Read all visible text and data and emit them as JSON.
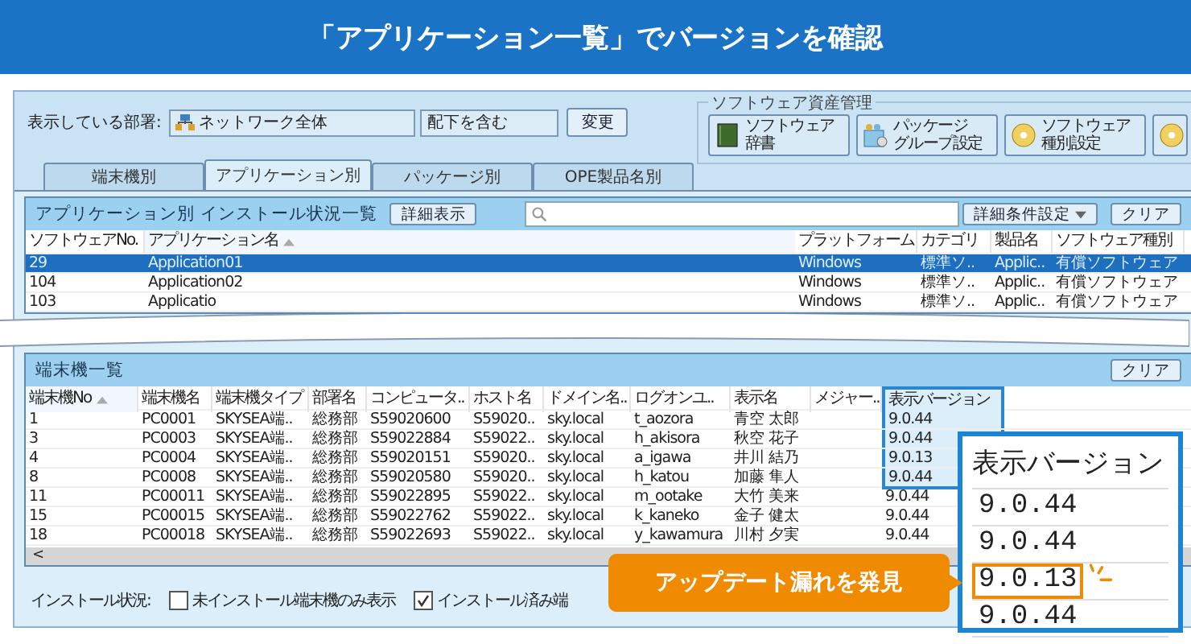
{
  "header": {
    "title": "「アプリケーション一覧」でバージョンを確認"
  },
  "toolbar": {
    "label": "表示している部署:",
    "department": "ネットワーク全体",
    "scope": "配下を含む",
    "change_button": "変更"
  },
  "asset_group": {
    "title": "ソフトウェア資産管理",
    "buttons": [
      {
        "kind": "book",
        "lines": [
          "ソフトウェア",
          "辞書"
        ]
      },
      {
        "kind": "package",
        "lines": [
          "パッケージ",
          "グループ設定"
        ]
      },
      {
        "kind": "disc",
        "lines": [
          "ソフトウェア",
          "種別設定"
        ]
      },
      {
        "kind": "disc"
      }
    ]
  },
  "tabs": [
    {
      "label": "端末機別",
      "selected": false
    },
    {
      "label": "アプリケーション別",
      "selected": true
    },
    {
      "label": "パッケージ別",
      "selected": false
    },
    {
      "label": "OPE製品名別",
      "selected": false
    }
  ],
  "app_panel": {
    "title": "アプリケーション別 インストール状況一覧",
    "detail_button": "詳細表示",
    "filter_button": "詳細条件設定",
    "clear_button": "クリア",
    "columns": [
      {
        "label": "ソフトウェアNo.",
        "sorted": false
      },
      {
        "label": "アプリケーション名",
        "sorted": true
      },
      {
        "label": "プラットフォーム",
        "sorted": false
      },
      {
        "label": "カテゴリ",
        "sorted": false
      },
      {
        "label": "製品名",
        "sorted": false
      },
      {
        "label": "ソフトウェア種別",
        "sorted": false
      }
    ],
    "rows": [
      {
        "selected": true,
        "cells": [
          "29",
          "Application01",
          "Windows",
          "標準ソ..",
          "Applic..",
          "有償ソフトウェア"
        ]
      },
      {
        "selected": false,
        "cells": [
          "104",
          "Application02",
          "Windows",
          "標準ソ..",
          "Applic..",
          "有償ソフトウェア"
        ]
      },
      {
        "selected": false,
        "cells": [
          "103",
          "Applicatio",
          "Windows",
          "標準ソ..",
          "Applic..",
          "有償ソフトウェア"
        ]
      }
    ]
  },
  "device_panel": {
    "title": "端末機一覧",
    "clear_button": "クリア",
    "columns": [
      {
        "label": "端末機No",
        "sorted": true,
        "highlighted": false
      },
      {
        "label": "端末機名",
        "sorted": false,
        "highlighted": false
      },
      {
        "label": "端末機タイプ",
        "sorted": false,
        "highlighted": false
      },
      {
        "label": "部署名",
        "sorted": false,
        "highlighted": false
      },
      {
        "label": "コンピュータ..",
        "sorted": false,
        "highlighted": false
      },
      {
        "label": "ホスト名",
        "sorted": false,
        "highlighted": false
      },
      {
        "label": "ドメイン名..",
        "sorted": false,
        "highlighted": false
      },
      {
        "label": "ログオンユ..",
        "sorted": false,
        "highlighted": false
      },
      {
        "label": "表示名",
        "sorted": false,
        "highlighted": false
      },
      {
        "label": "メジャー..",
        "sorted": false,
        "highlighted": false
      },
      {
        "label": "表示バージョン",
        "sorted": false,
        "highlighted": true
      }
    ],
    "rows": [
      {
        "highlighted": true,
        "cells": [
          "1",
          "PC0001",
          "SKYSEA端..",
          "総務部",
          "S59020600",
          "S59020..",
          "sky.local",
          "t_aozora",
          "青空 太郎",
          null,
          "9.0.44"
        ]
      },
      {
        "highlighted": true,
        "cells": [
          "3",
          "PC0003",
          "SKYSEA端..",
          "総務部",
          "S59022884",
          "S59022..",
          "sky.local",
          "h_akisora",
          "秋空 花子",
          null,
          "9.0.44"
        ]
      },
      {
        "highlighted": true,
        "cells": [
          "4",
          "PC0004",
          "SKYSEA端..",
          "総務部",
          "S59020151",
          "S59020..",
          "sky.local",
          "a_igawa",
          "井川 結乃",
          null,
          "9.0.13"
        ]
      },
      {
        "highlighted": true,
        "cells": [
          "8",
          "PC0008",
          "SKYSEA端..",
          "総務部",
          "S59020580",
          "S59020..",
          "sky.local",
          "h_katou",
          "加藤 隼人",
          null,
          "9.0.44"
        ]
      },
      {
        "highlighted": false,
        "cells": [
          "11",
          "PC00011",
          "SKYSEA端..",
          "総務部",
          "S59022895",
          "S59022..",
          "sky.local",
          "m_ootake",
          "大竹 美来",
          null,
          "9.0.44"
        ]
      },
      {
        "highlighted": false,
        "cells": [
          "15",
          "PC00015",
          "SKYSEA端..",
          "総務部",
          "S59022762",
          "S59022..",
          "sky.local",
          "k_kaneko",
          "金子 健太",
          null,
          "9.0.44"
        ]
      },
      {
        "highlighted": false,
        "cells": [
          "18",
          "PC00018",
          "SKYSEA端..",
          "総務部",
          "S59022693",
          "S59022..",
          "sky.local",
          "y_kawamura",
          "川村 夕実",
          null,
          "9.0.44"
        ]
      }
    ],
    "scroll_left": "<"
  },
  "install_filter": {
    "label": "インストール状況:",
    "options": [
      {
        "label": "未インストール端末機のみ表示",
        "checked": false
      },
      {
        "label": "インストール済み端",
        "checked": true
      }
    ]
  },
  "zoom_callout": {
    "heading": "表示バージョン",
    "values": [
      {
        "text": "9.0.44",
        "flagged": false
      },
      {
        "text": "9.0.44",
        "flagged": false
      },
      {
        "text": "9.0.13",
        "flagged": true
      },
      {
        "text": "9.0.44",
        "flagged": false
      }
    ]
  },
  "alert": {
    "text": "アップデート漏れを発見"
  }
}
